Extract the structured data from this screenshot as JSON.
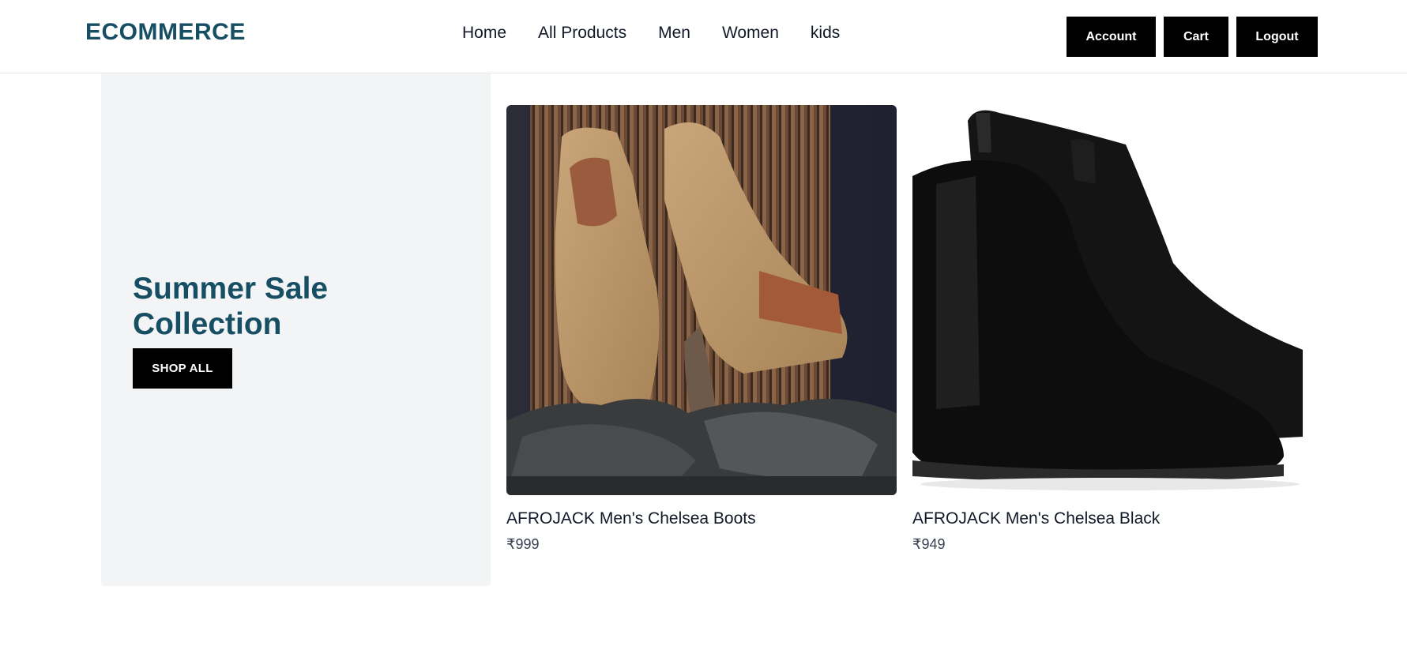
{
  "brand": "ECOMMERCE",
  "nav": {
    "items": [
      "Home",
      "All Products",
      "Men",
      "Women",
      "kids"
    ]
  },
  "header_buttons": {
    "account": "Account",
    "cart": "Cart",
    "logout": "Logout"
  },
  "hero": {
    "title_line1": "Summer Sale",
    "title_line2": "Collection",
    "cta": "SHOP ALL",
    "background": "#f3f4f6",
    "title_color": "#164e63"
  },
  "products": [
    {
      "name": "AFROJACK Men's Chelsea Boots",
      "price": "₹999"
    },
    {
      "name": "AFROJACK Men's Chelsea Black",
      "price": "₹949"
    }
  ],
  "colors": {
    "brand": "#164e63",
    "button_bg": "#000000",
    "button_text": "#ffffff"
  }
}
